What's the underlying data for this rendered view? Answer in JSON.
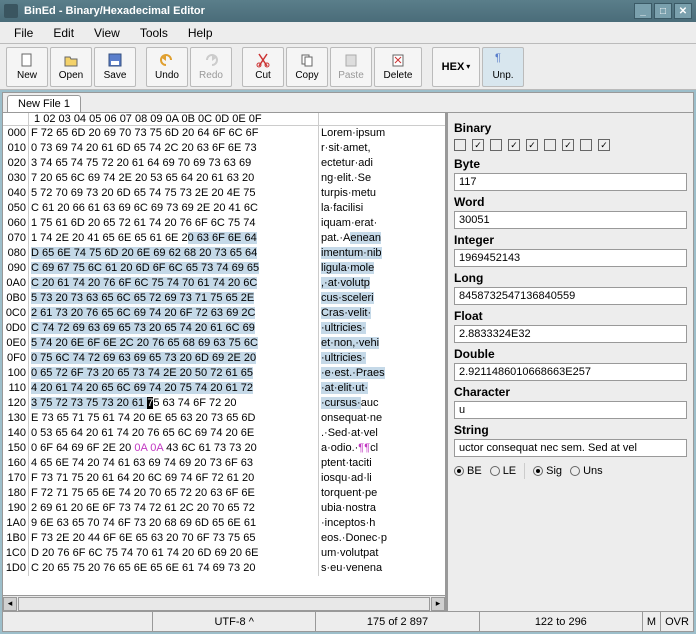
{
  "window": {
    "title": "BinEd - Binary/Hexadecimal Editor"
  },
  "menu": {
    "file": "File",
    "edit": "Edit",
    "view": "View",
    "tools": "Tools",
    "help": "Help"
  },
  "toolbar": {
    "new": "New",
    "open": "Open",
    "save": "Save",
    "undo": "Undo",
    "redo": "Redo",
    "cut": "Cut",
    "copy": "Copy",
    "paste": "Paste",
    "delete": "Delete",
    "hex": "HEX",
    "unp": "Unp."
  },
  "tab": {
    "name": "New File 1"
  },
  "hex": {
    "header": " 1 02 03 04 05 06 07 08 09 0A 0B 0C 0D 0E 0F",
    "rows": [
      {
        "a": "000",
        "h": "F 72 65 6D 20 69 70 73 75 6D 20 64 6F 6C 6F",
        "t": "Lorem·ipsum"
      },
      {
        "a": "010",
        "h": "0 73 69 74 20 61 6D 65 74 2C 20 63 6F 6E 73",
        "t": "r·sit·amet,"
      },
      {
        "a": "020",
        "h": "3 74 65 74 75 72 20 61 64 69 70 69 73 63 69",
        "t": "ectetur·adi"
      },
      {
        "a": "030",
        "h": "7 20 65 6C 69 74 2E 20 53 65 64 20 61 63 20",
        "t": "ng·elit.·Se"
      },
      {
        "a": "040",
        "h": "5 72 70 69 73 20 6D 65 74 75 73 2E 20 4E 75",
        "t": "turpis·metu"
      },
      {
        "a": "050",
        "h": "C 61 20 66 61 63 69 6C 69 73 69 2E 20 41 6C",
        "t": "la·facilisi"
      },
      {
        "a": "060",
        "h": "1 75 61 6D 20 65 72 61 74 20 76 6F 6C 75 74",
        "t": "iquam·erat·"
      },
      {
        "a": "070",
        "h": "1 74 2E 20 41 65 6E 65 61 6E 20 63 6F 6E 64",
        "t": "pat.·Aenean",
        "ssel": 10,
        "tsel": 6
      },
      {
        "a": "080",
        "h": "D 65 6E 74 75 6D 20 6E 69 62 68 20 73 65 64",
        "t": "imentum·nib",
        "allsel": true
      },
      {
        "a": "090",
        "h": "C 69 67 75 6C 61 20 6D 6F 6C 65 73 74 69 65",
        "t": "ligula·mole",
        "allsel": true
      },
      {
        "a": "0A0",
        "h": "C 20 61 74 20 76 6F 6C 75 74 70 61 74 20 6C",
        "t": ",·at·volutp",
        "allsel": true
      },
      {
        "a": "0B0",
        "h": "5 73 20 73 63 65 6C 65 72 69 73 71 75 65 2E",
        "t": "cus·sceleri",
        "allsel": true
      },
      {
        "a": "0C0",
        "h": "2 61 73 20 76 65 6C 69 74 20 6F 72 63 69 2C",
        "t": "Cras·velit·",
        "allsel": true
      },
      {
        "a": "0D0",
        "h": "C 74 72 69 63 69 65 73 20 65 74 20 61 6C 69",
        "t": "·ultricies·",
        "allsel": true
      },
      {
        "a": "0E0",
        "h": "5 74 20 6E 6F 6E 2C 20 76 65 68 69 63 75 6C",
        "t": "et·non,·vehi",
        "allsel": true
      },
      {
        "a": "0F0",
        "h": "0 75 6C 74 72 69 63 69 65 73 20 6D 69 2E 20",
        "t": "·ultricies·",
        "allsel": true
      },
      {
        "a": "100",
        "h": "0 65 72 6F 73 20 65 73 74 2E 20 50 72 61 65",
        "t": "·e·est.·Praes",
        "allsel": true
      },
      {
        "a": "110",
        "h": "4 20 61 74 20 65 6C 69 74 20 75 74 20 61 72",
        "t": "·at·elit·ut·",
        "allsel": true
      },
      {
        "a": "120",
        "h": "3 75 72 73 75 73 20 61 ",
        "t": "·cursus·auc",
        "esel": 8,
        "cursor": "7",
        "rest": "5 63 74 6F 72 20",
        "tesel": 8
      },
      {
        "a": "130",
        "h": "E 73 65 71 75 61 74 20 6E 65 63 20 73 65 6D",
        "t": "onsequat·ne"
      },
      {
        "a": "140",
        "h": "0 53 65 64 20 61 74 20 76 65 6C 69 74 20 6E",
        "t": ".·Sed·at·vel"
      },
      {
        "a": "150",
        "h": "0 6F 64 69 6F 2E 20 ",
        "pil": "0A 0A",
        "rest2": " 43 6C 61 73 73 20",
        "t": "a·odio.·¶¶cl"
      },
      {
        "a": "160",
        "h": "4 65 6E 74 20 74 61 63 69 74 69 20 73 6F 63",
        "t": "ptent·taciti"
      },
      {
        "a": "170",
        "h": "F 73 71 75 20 61 64 20 6C 69 74 6F 72 61 20",
        "t": "iosqu·ad·li"
      },
      {
        "a": "180",
        "h": "F 72 71 75 65 6E 74 20 70 65 72 20 63 6F 6E",
        "t": "torquent·pe"
      },
      {
        "a": "190",
        "h": "2 69 61 20 6E 6F 73 74 72 61 2C 20 70 65 72",
        "t": "ubia·nostra"
      },
      {
        "a": "1A0",
        "h": "9 6E 63 65 70 74 6F 73 20 68 69 6D 65 6E 61",
        "t": "·inceptos·h"
      },
      {
        "a": "1B0",
        "h": "F 73 2E 20 44 6F 6E 65 63 20 70 6F 73 75 65",
        "t": "eos.·Donec·p"
      },
      {
        "a": "1C0",
        "h": "D 20 76 6F 6C 75 74 70 61 74 20 6D 69 20 6E",
        "t": "um·volutpat"
      },
      {
        "a": "1D0",
        "h": "C 20 65 75 20 76 65 6E 65 6E 61 74 69 73 20",
        "t": "s·eu·venena"
      }
    ]
  },
  "side": {
    "binary_label": "Binary",
    "checks": [
      "",
      "✓",
      "",
      "✓",
      "✓",
      "",
      "✓",
      "",
      "✓"
    ],
    "byte_label": "Byte",
    "byte": "117",
    "word_label": "Word",
    "word": "30051",
    "integer_label": "Integer",
    "integer": "1969452143",
    "long_label": "Long",
    "long": "8458732547136840559",
    "float_label": "Float",
    "float": "2.8833324E32",
    "double_label": "Double",
    "double": "2.9211486010668663E257",
    "character_label": "Character",
    "character": "u",
    "string_label": "String",
    "string": "uctor consequat nec sem. Sed at vel",
    "be": "BE",
    "le": "LE",
    "sig": "Sig",
    "uns": "Uns"
  },
  "status": {
    "encoding": "UTF-8 ^",
    "position": "175 of 2 897",
    "selection": "122 to 296",
    "mode1": "M",
    "mode2": "OVR"
  }
}
